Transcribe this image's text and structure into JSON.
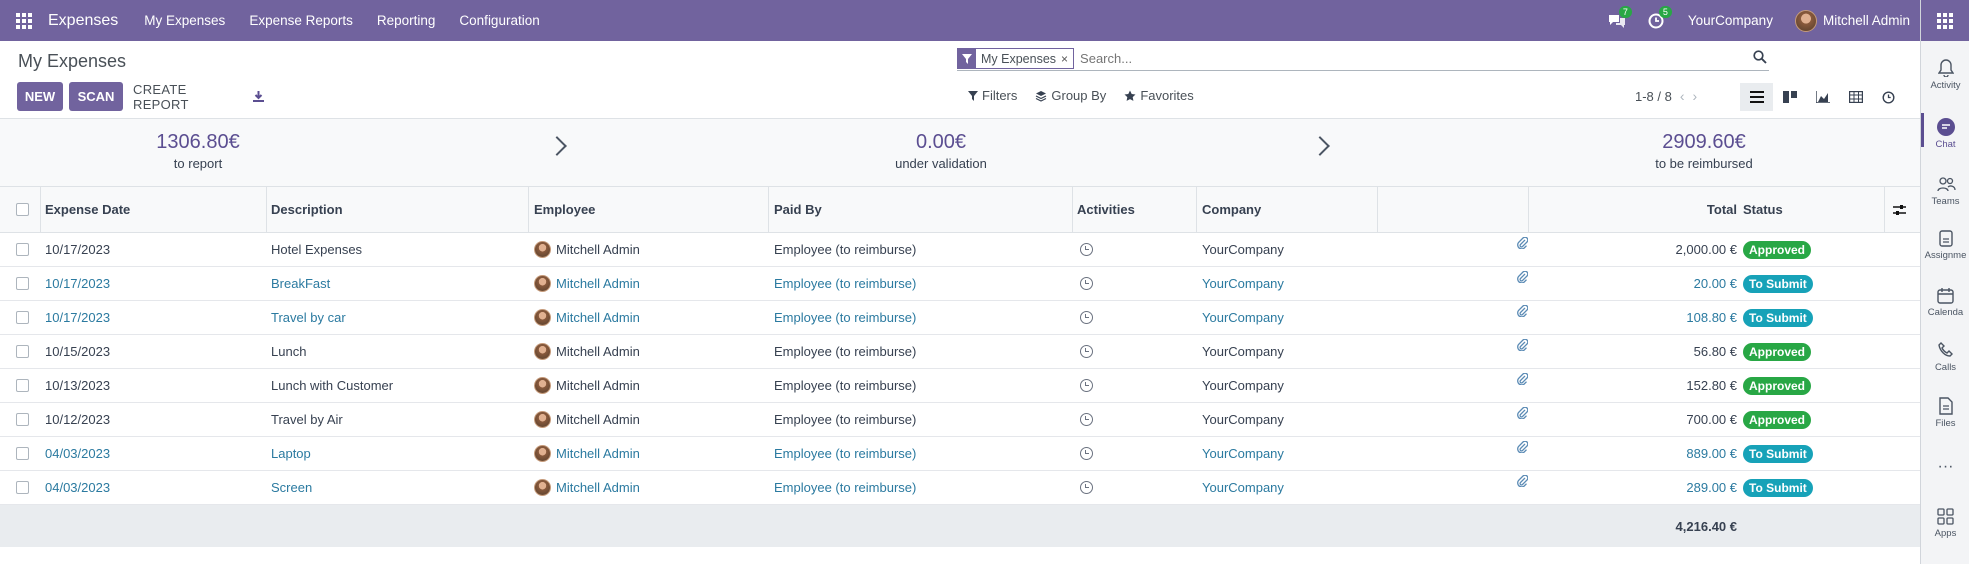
{
  "navbar": {
    "brand": "Expenses",
    "menu": [
      "My Expenses",
      "Expense Reports",
      "Reporting",
      "Configuration"
    ],
    "messages_count": "7",
    "activities_count": "5",
    "company": "YourCompany",
    "user": "Mitchell Admin"
  },
  "control_panel": {
    "breadcrumb": "My Expenses",
    "new_label": "NEW",
    "scan_label": "SCAN",
    "create_report_label": "CREATE REPORT",
    "facet_label": "My Expenses",
    "facet_remove": "×",
    "search_placeholder": "Search...",
    "filters_label": "Filters",
    "group_by_label": "Group By",
    "favorites_label": "Favorites",
    "pager": "1-8 / 8"
  },
  "summary": {
    "to_report_amount": "1306.80€",
    "to_report_label": "to report",
    "under_validation_amount": "0.00€",
    "under_validation_label": "under validation",
    "to_reimburse_amount": "2909.60€",
    "to_reimburse_label": "to be reimbursed"
  },
  "table": {
    "headers": {
      "date": "Expense Date",
      "description": "Description",
      "employee": "Employee",
      "paid_by": "Paid By",
      "activities": "Activities",
      "company": "Company",
      "total": "Total",
      "status": "Status"
    },
    "rows": [
      {
        "date": "10/17/2023",
        "description": "Hotel Expenses",
        "employee": "Mitchell Admin",
        "paid_by": "Employee (to reimburse)",
        "company": "YourCompany",
        "total": "2,000.00 €",
        "status": "Approved",
        "link": false
      },
      {
        "date": "10/17/2023",
        "description": "BreakFast",
        "employee": "Mitchell Admin",
        "paid_by": "Employee (to reimburse)",
        "company": "YourCompany",
        "total": "20.00 €",
        "status": "To Submit",
        "link": true
      },
      {
        "date": "10/17/2023",
        "description": "Travel by car",
        "employee": "Mitchell Admin",
        "paid_by": "Employee (to reimburse)",
        "company": "YourCompany",
        "total": "108.80 €",
        "status": "To Submit",
        "link": true
      },
      {
        "date": "10/15/2023",
        "description": "Lunch",
        "employee": "Mitchell Admin",
        "paid_by": "Employee (to reimburse)",
        "company": "YourCompany",
        "total": "56.80 €",
        "status": "Approved",
        "link": false
      },
      {
        "date": "10/13/2023",
        "description": "Lunch with Customer",
        "employee": "Mitchell Admin",
        "paid_by": "Employee (to reimburse)",
        "company": "YourCompany",
        "total": "152.80 €",
        "status": "Approved",
        "link": false
      },
      {
        "date": "10/12/2023",
        "description": "Travel by Air",
        "employee": "Mitchell Admin",
        "paid_by": "Employee (to reimburse)",
        "company": "YourCompany",
        "total": "700.00 €",
        "status": "Approved",
        "link": false
      },
      {
        "date": "04/03/2023",
        "description": "Laptop",
        "employee": "Mitchell Admin",
        "paid_by": "Employee (to reimburse)",
        "company": "YourCompany",
        "total": "889.00 €",
        "status": "To Submit",
        "link": true
      },
      {
        "date": "04/03/2023",
        "description": "Screen",
        "employee": "Mitchell Admin",
        "paid_by": "Employee (to reimburse)",
        "company": "YourCompany",
        "total": "289.00 €",
        "status": "To Submit",
        "link": true
      }
    ],
    "grand_total": "4,216.40 €"
  },
  "sidebar": {
    "items": [
      "Activity",
      "Chat",
      "Teams",
      "Assignme",
      "Calenda",
      "Calls",
      "Files",
      "Apps"
    ]
  },
  "colors": {
    "brand": "#71639e",
    "approved": "#28a745",
    "to_submit": "#17a2b8",
    "link": "#2b7aa0"
  }
}
